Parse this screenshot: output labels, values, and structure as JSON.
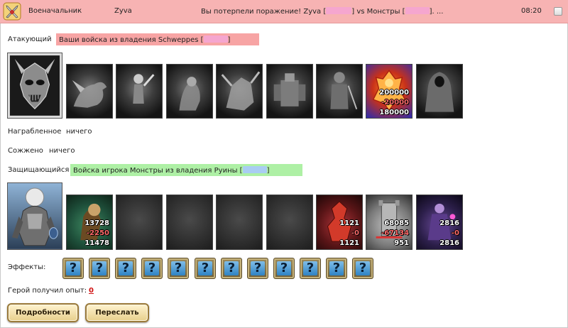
{
  "header": {
    "sender": "Военачальник",
    "player": "Zyva",
    "subject_prefix": "Вы потерпели поражение! Zyva [",
    "subject_middle": "] vs Монстры [",
    "subject_suffix": "]. ...",
    "time": "08:20",
    "bg_color": "#f7b3b3"
  },
  "attacker": {
    "label": "Атакующий",
    "banner_prefix": "Ваши войска из владения Schweppes [",
    "banner_suffix": "]",
    "hero_icon": "demon-skull-hero-portrait",
    "units": [
      {
        "icon": "dragon-unit-icon"
      },
      {
        "icon": "skeleton-warrior-unit-icon"
      },
      {
        "icon": "ghoul-unit-icon"
      },
      {
        "icon": "bone-dragon-unit-icon"
      },
      {
        "icon": "golem-unit-icon"
      },
      {
        "icon": "knight-unit-icon"
      },
      {
        "icon": "fire-demon-unit-icon",
        "initial": "200000",
        "lost": "-20000",
        "remaining": "180000"
      },
      {
        "icon": "reaper-unit-icon"
      }
    ]
  },
  "looted": {
    "label": "Награбленное",
    "value": "ничего"
  },
  "burned": {
    "label": "Сожжено",
    "value": "ничего"
  },
  "defender": {
    "label": "Защищающийся",
    "banner_prefix": "Войска игрока Монстры из владения Руины [",
    "banner_suffix": "]",
    "hero_icon": "armored-warrior-hero-portrait",
    "units": [
      {
        "icon": "treant-unit-icon",
        "initial": "13728",
        "lost": "-2250",
        "remaining": "11478"
      },
      {
        "icon": "empty-slot"
      },
      {
        "icon": "empty-slot"
      },
      {
        "icon": "empty-slot"
      },
      {
        "icon": "empty-slot"
      },
      {
        "icon": "red-demon-unit-icon",
        "initial": "1121",
        "lost": "-0",
        "remaining": "1121"
      },
      {
        "icon": "siege-tower-unit-icon",
        "initial": "68085",
        "lost": "-67134",
        "remaining": "951"
      },
      {
        "icon": "purple-sorcerer-unit-icon",
        "initial": "2816",
        "lost": "-0",
        "remaining": "2816"
      }
    ]
  },
  "effects": {
    "label": "Эффекты:",
    "items": [
      "?",
      "?",
      "?",
      "?",
      "?",
      "?",
      "?",
      "?",
      "?",
      "?",
      "?",
      "?"
    ]
  },
  "experience": {
    "label": "Герой получил опыт:",
    "value": "0"
  },
  "buttons": {
    "details": "Подробности",
    "forward": "Переслать"
  },
  "colors": {
    "attacker_banner": "#f7a4a4",
    "defender_banner": "#aef0a5",
    "loss_number": "#ff6b6b",
    "experience_value": "#d01010"
  }
}
